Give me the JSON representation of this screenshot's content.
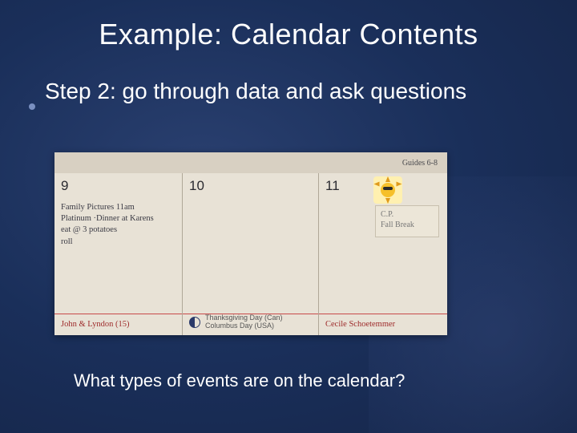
{
  "title": "Example: Calendar Contents",
  "bullet": "Step 2: go through data and ask questions",
  "caption": "What types of events are on the calendar?",
  "calendar": {
    "top_note": "Guides   6-8",
    "columns": [
      {
        "day": "9",
        "lines": "Family Pictures  11am\nPlatinum  ·Dinner at Karens\n     eat @ 3  potatoes\n                    roll",
        "bottom_red": "John & Lyndon (15)",
        "footer": ""
      },
      {
        "day": "10",
        "lines": "",
        "bottom_red": "",
        "footer_left": "Thanksgiving Day (Can)",
        "footer_right": "Columbus Day (USA)"
      },
      {
        "day": "11",
        "sticky_line1": "C.P.",
        "sticky_line2": "Fall Break",
        "bottom_red": "Cecile  Schoetemmer",
        "footer": ""
      }
    ]
  }
}
